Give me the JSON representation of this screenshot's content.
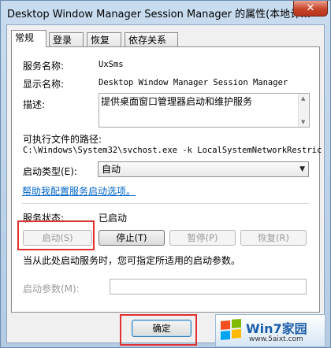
{
  "window": {
    "title": "Desktop Window Manager Session Manager 的属性(本地计…",
    "close_glyph": "✕"
  },
  "tabs": [
    {
      "label": "常规",
      "active": true
    },
    {
      "label": "登录",
      "active": false
    },
    {
      "label": "恢复",
      "active": false
    },
    {
      "label": "依存关系",
      "active": false
    }
  ],
  "general": {
    "service_name_label": "服务名称:",
    "service_name": "UxSms",
    "display_name_label": "显示名称:",
    "display_name": "Desktop Window Manager Session Manager",
    "description_label": "描述:",
    "description": "提供桌面窗口管理器启动和维护服务",
    "exe_path_label": "可执行文件的路径:",
    "exe_path": "C:\\Windows\\System32\\svchost.exe -k LocalSystemNetworkRestric",
    "startup_type_label": "启动类型(E):",
    "startup_type_value": "自动",
    "help_link": "帮助我配置服务启动选项。",
    "status_label": "服务状态:",
    "status_value": "已启动",
    "buttons": {
      "start": "启动(S)",
      "stop": "停止(T)",
      "pause": "暂停(P)",
      "resume": "恢复(R)"
    },
    "start_hint": "当从此处启动服务时，您可指定所适用的启动参数。",
    "start_params_label": "启动参数(M):",
    "start_params_value": ""
  },
  "footer": {
    "ok": "确定"
  },
  "watermark": {
    "brand": "Win7家园",
    "url": "www.5aixt.com"
  },
  "colors": {
    "highlight_box": "#e03030",
    "link": "#0066cc"
  }
}
